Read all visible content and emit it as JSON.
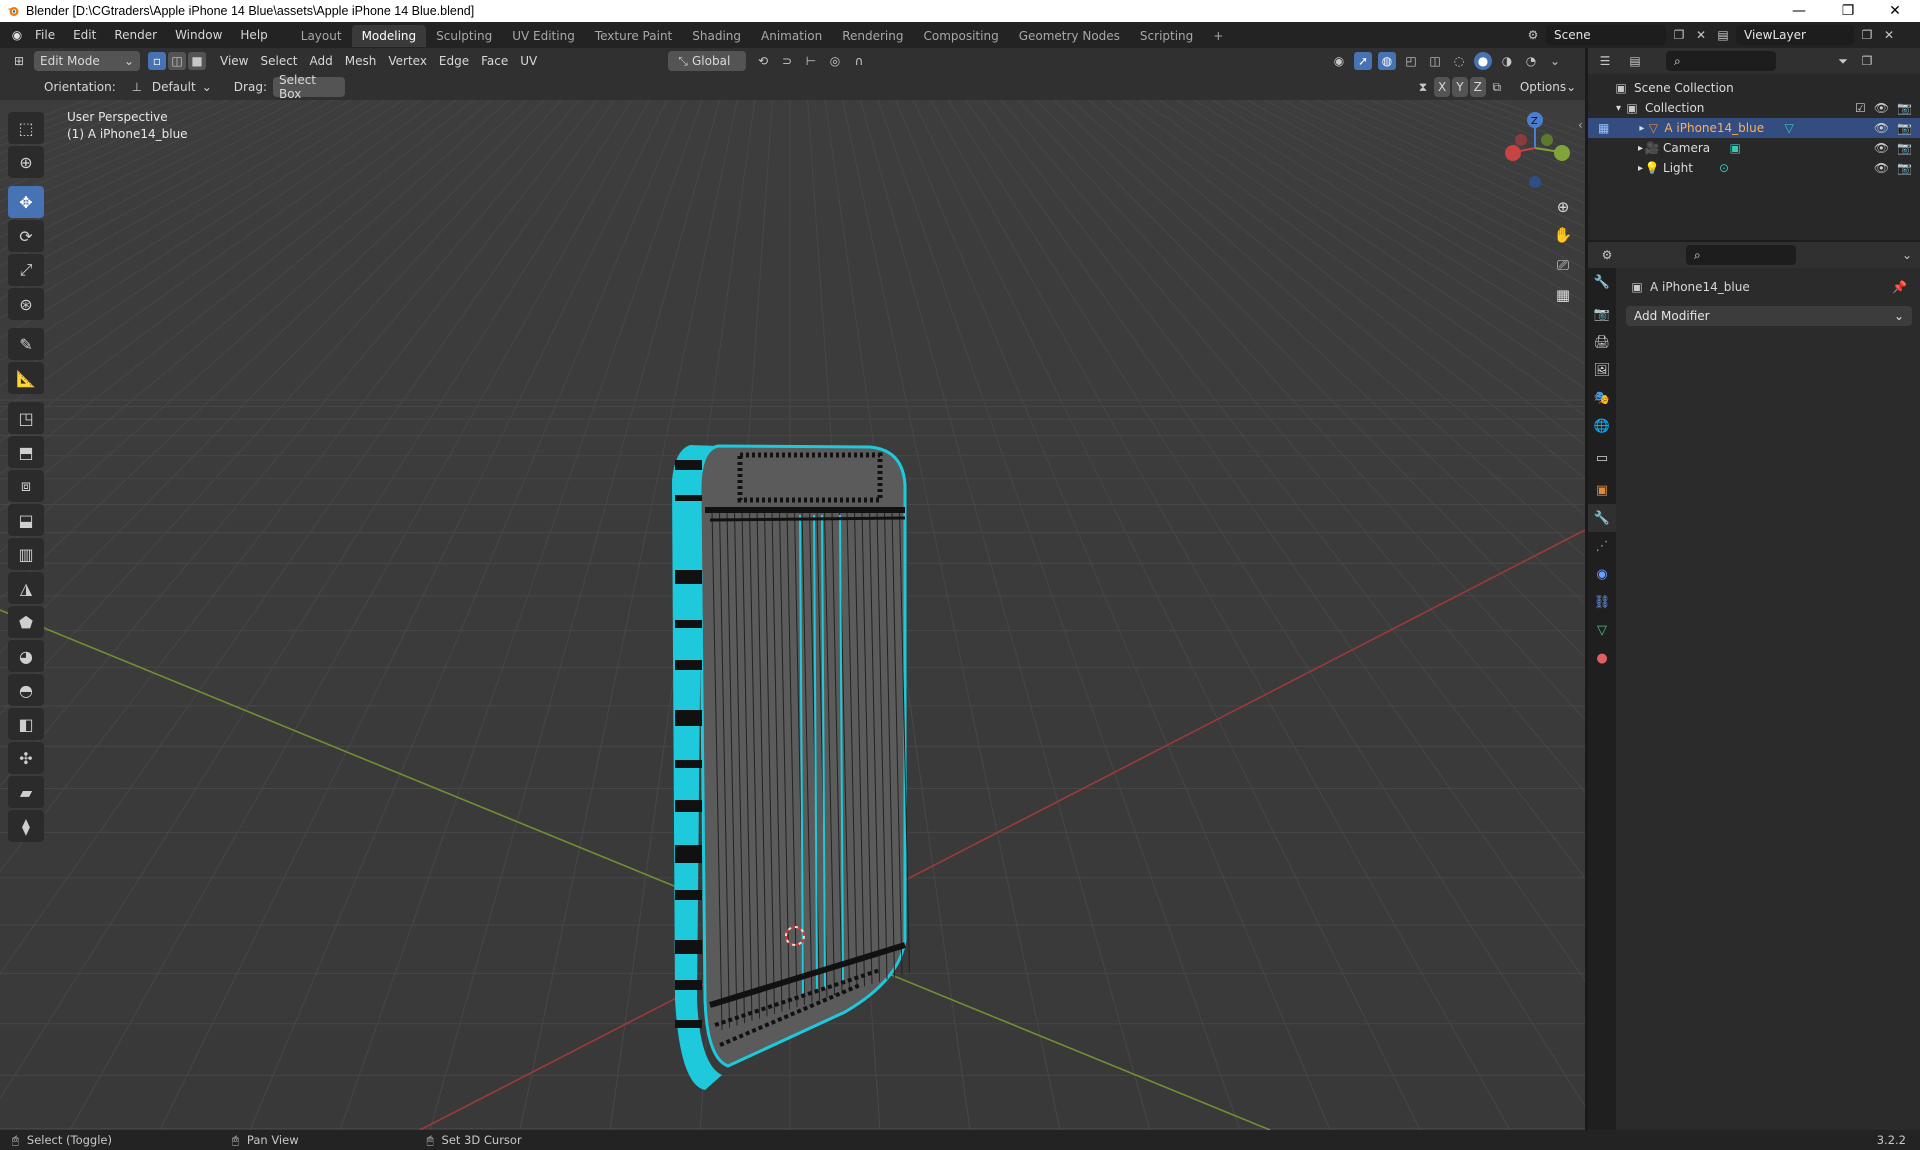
{
  "window": {
    "title": "Blender [D:\\CGtraders\\Apple iPhone 14 Blue\\assets\\Apple iPhone 14 Blue.blend]",
    "minimize": "—",
    "maximize": "❐",
    "close": "✕"
  },
  "menu": [
    "File",
    "Edit",
    "Render",
    "Window",
    "Help"
  ],
  "workspaces": [
    "Layout",
    "Modeling",
    "Sculpting",
    "UV Editing",
    "Texture Paint",
    "Shading",
    "Animation",
    "Rendering",
    "Compositing",
    "Geometry Nodes",
    "Scripting"
  ],
  "active_workspace": "Modeling",
  "add_workspace": "+",
  "scene": {
    "name": "Scene",
    "view_layer": "ViewLayer"
  },
  "viewport_header": {
    "mode": "Edit Mode",
    "menus": [
      "View",
      "Select",
      "Add",
      "Mesh",
      "Vertex",
      "Edge",
      "Face",
      "UV"
    ],
    "transform_orientation": "Global",
    "orientation_label": "Orientation:",
    "orientation_value": "Default",
    "drag_label": "Drag:",
    "drag_value": "Select Box",
    "axes": [
      "X",
      "Y",
      "Z"
    ],
    "options": "Options"
  },
  "viewport": {
    "view_name": "User Perspective",
    "object_label": "(1) A iPhone14_blue",
    "gizmo_labels": {
      "z": "Z"
    }
  },
  "outliner": {
    "root": "Scene Collection",
    "collection": "Collection",
    "items": [
      {
        "name": "A iPhone14_blue",
        "selected": true
      },
      {
        "name": "Camera",
        "selected": false
      },
      {
        "name": "Light",
        "selected": false
      }
    ]
  },
  "properties": {
    "object_name": "A iPhone14_blue",
    "add_modifier": "Add Modifier"
  },
  "statusbar": {
    "select": "Select (Toggle)",
    "pan": "Pan View",
    "cursor": "Set 3D Cursor",
    "version": "3.2.2"
  },
  "colors": {
    "accent": "#4772b3",
    "selection_cyan": "#1ed3e6",
    "axis_red": "#c83a3a",
    "axis_green": "#7fa83a"
  }
}
